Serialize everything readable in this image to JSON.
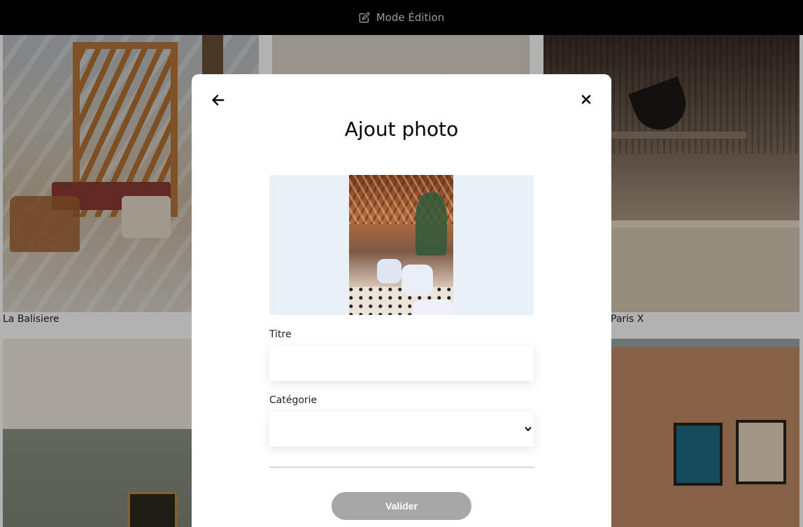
{
  "edit_bar": {
    "label": "Mode Édition",
    "icon": "edit-icon"
  },
  "gallery": {
    "captions": [
      "La Balisiere",
      "Paris X"
    ]
  },
  "modal": {
    "title": "Ajout photo",
    "back_icon": "arrow-left-icon",
    "close_icon": "close-icon",
    "title_field_label": "Titre",
    "title_field_value": "",
    "category_field_label": "Catégorie",
    "category_selected": "",
    "submit_label": "Valider"
  },
  "colors": {
    "edit_bar_bg": "#000000",
    "preview_bg": "#e8f1f6",
    "submit_disabled": "#a7a7a7"
  }
}
